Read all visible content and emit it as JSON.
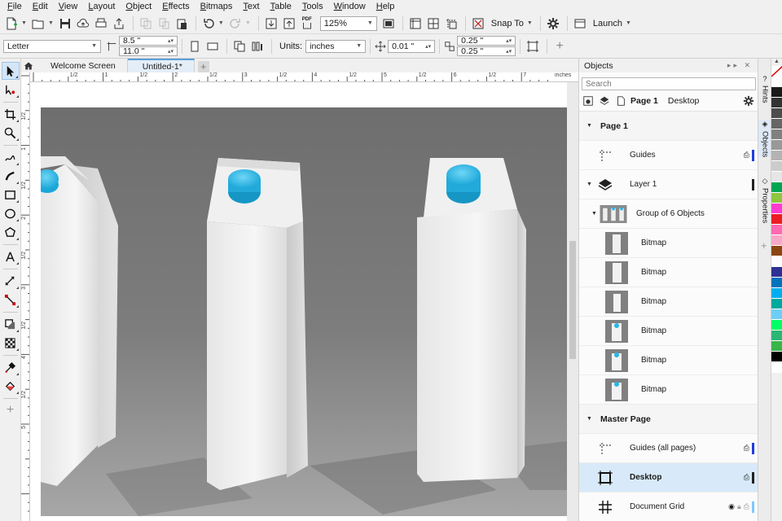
{
  "menu": [
    "File",
    "Edit",
    "View",
    "Layout",
    "Object",
    "Effects",
    "Bitmaps",
    "Text",
    "Table",
    "Tools",
    "Window",
    "Help"
  ],
  "toolbar": {
    "zoom": "125%",
    "snap_to": "Snap To",
    "launch": "Launch",
    "pdf_label": "PDF"
  },
  "property_bar": {
    "page_size": "Letter",
    "width": "8.5 \"",
    "height": "11.0 \"",
    "units_label": "Units:",
    "units": "inches",
    "nudge": "0.01 \"",
    "dup_x": "0.25 \"",
    "dup_y": "0.25 \""
  },
  "tabs": {
    "welcome": "Welcome Screen",
    "document": "Untitled-1*"
  },
  "ruler": {
    "unit": "inches",
    "h_labels": [
      "1/2",
      "1",
      "1/2",
      "2",
      "1/2",
      "3",
      "1/2",
      "4",
      "1/2",
      "5",
      "1/2",
      "6",
      "1/2",
      "7"
    ],
    "v_labels": [
      "1/2",
      "1",
      "1/2",
      "2",
      "1/2",
      "3",
      "1/2",
      "4",
      "1/2",
      "5"
    ]
  },
  "objects_panel": {
    "title": "Objects",
    "search_placeholder": "Search",
    "current_page": "Page 1",
    "current_view": "Desktop",
    "page1": "Page 1",
    "guides": "Guides",
    "layer1": "Layer 1",
    "group": "Group of 6 Objects",
    "bitmaps": [
      "Bitmap",
      "Bitmap",
      "Bitmap",
      "Bitmap",
      "Bitmap",
      "Bitmap"
    ],
    "master_page": "Master Page",
    "guides_all": "Guides (all pages)",
    "desktop": "Desktop",
    "document_grid": "Document Grid"
  },
  "side_tabs": [
    "Hints",
    "Objects",
    "Properties"
  ],
  "palette": [
    "#ffffff",
    "#1a1a1a",
    "#333333",
    "#4d4d4d",
    "#666666",
    "#808080",
    "#999999",
    "#b3b3b3",
    "#cccccc",
    "#e6e6e6",
    "#00a651",
    "#8dc63f",
    "#ff3ad0",
    "#ed1c24",
    "#ff69b4",
    "#f7a8c8",
    "#8b4513",
    "#ffffff",
    "#2e3192",
    "#0072bc",
    "#00aeef",
    "#00a99d",
    "#6dcff6",
    "#00ff66",
    "#2bb673",
    "#39b54a",
    "#000000",
    "#ffffff"
  ],
  "colors": {
    "accent": "#5a9fd8",
    "selection": "#d8eaf9",
    "cap_blue": "#29b6e6",
    "layer_bar": "#1e3ce0"
  }
}
